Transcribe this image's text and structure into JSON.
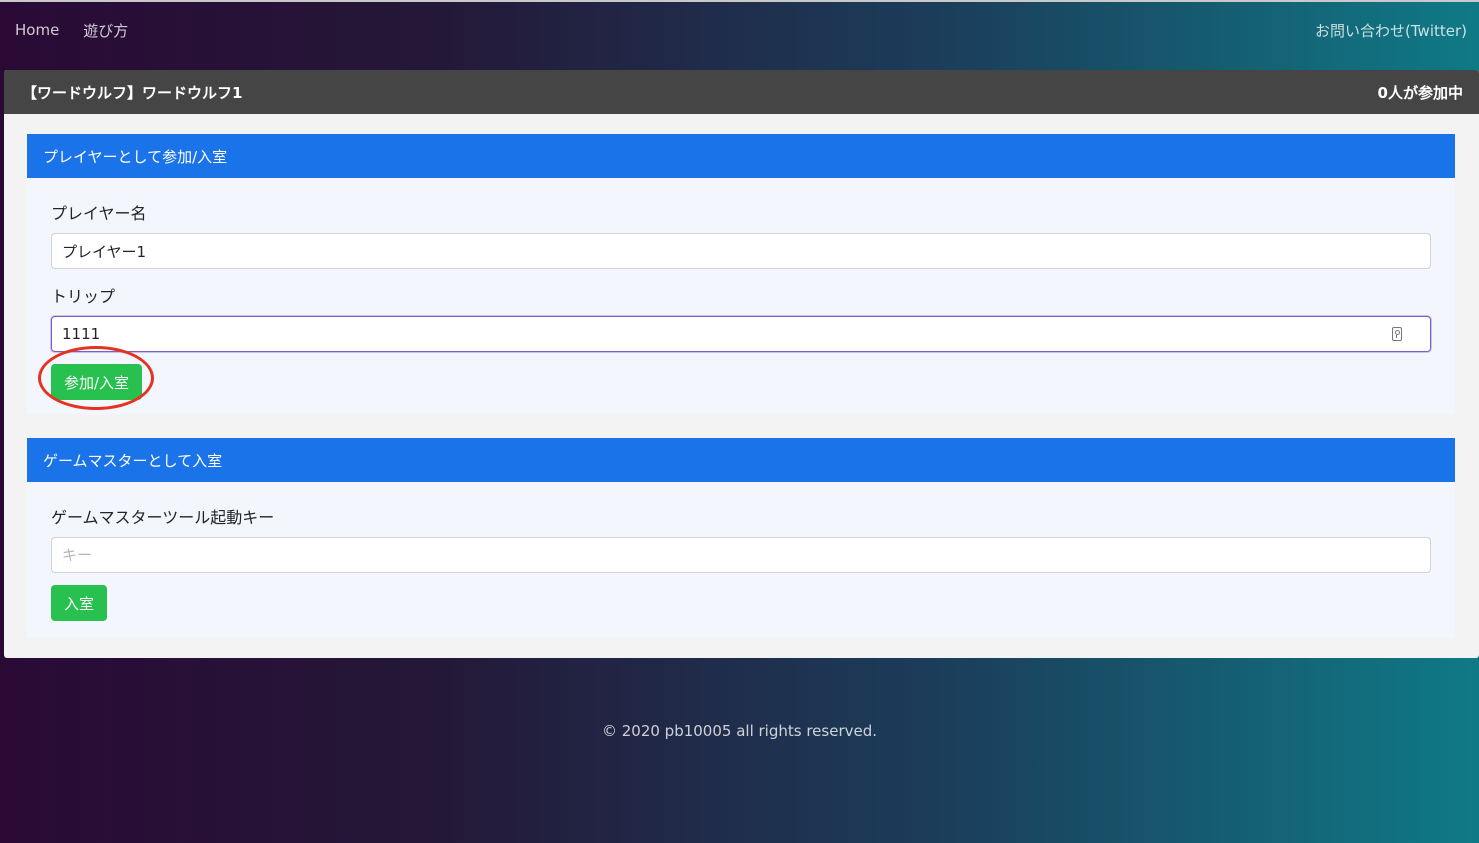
{
  "nav": {
    "home": "Home",
    "how_to_play": "遊び方",
    "contact": "お問い合わせ(Twitter)"
  },
  "room": {
    "title": "【ワードウルフ】ワードウルフ1",
    "participants": "0人が参加中"
  },
  "player_panel": {
    "header": "プレイヤーとして参加/入室",
    "name_label": "プレイヤー名",
    "name_value": "プレイヤー1",
    "trip_label": "トリップ",
    "trip_value": "1111",
    "join_button": "参加/入室"
  },
  "gm_panel": {
    "header": "ゲームマスターとして入室",
    "key_label": "ゲームマスターツール起動キー",
    "key_placeholder": "キー",
    "enter_button": "入室"
  },
  "footer": {
    "copyright": "© 2020 pb10005 all rights reserved."
  },
  "colors": {
    "panel_header": "#1a73e8",
    "button_green": "#28c04f",
    "card_header": "#454545",
    "annotation": "#e53321"
  }
}
